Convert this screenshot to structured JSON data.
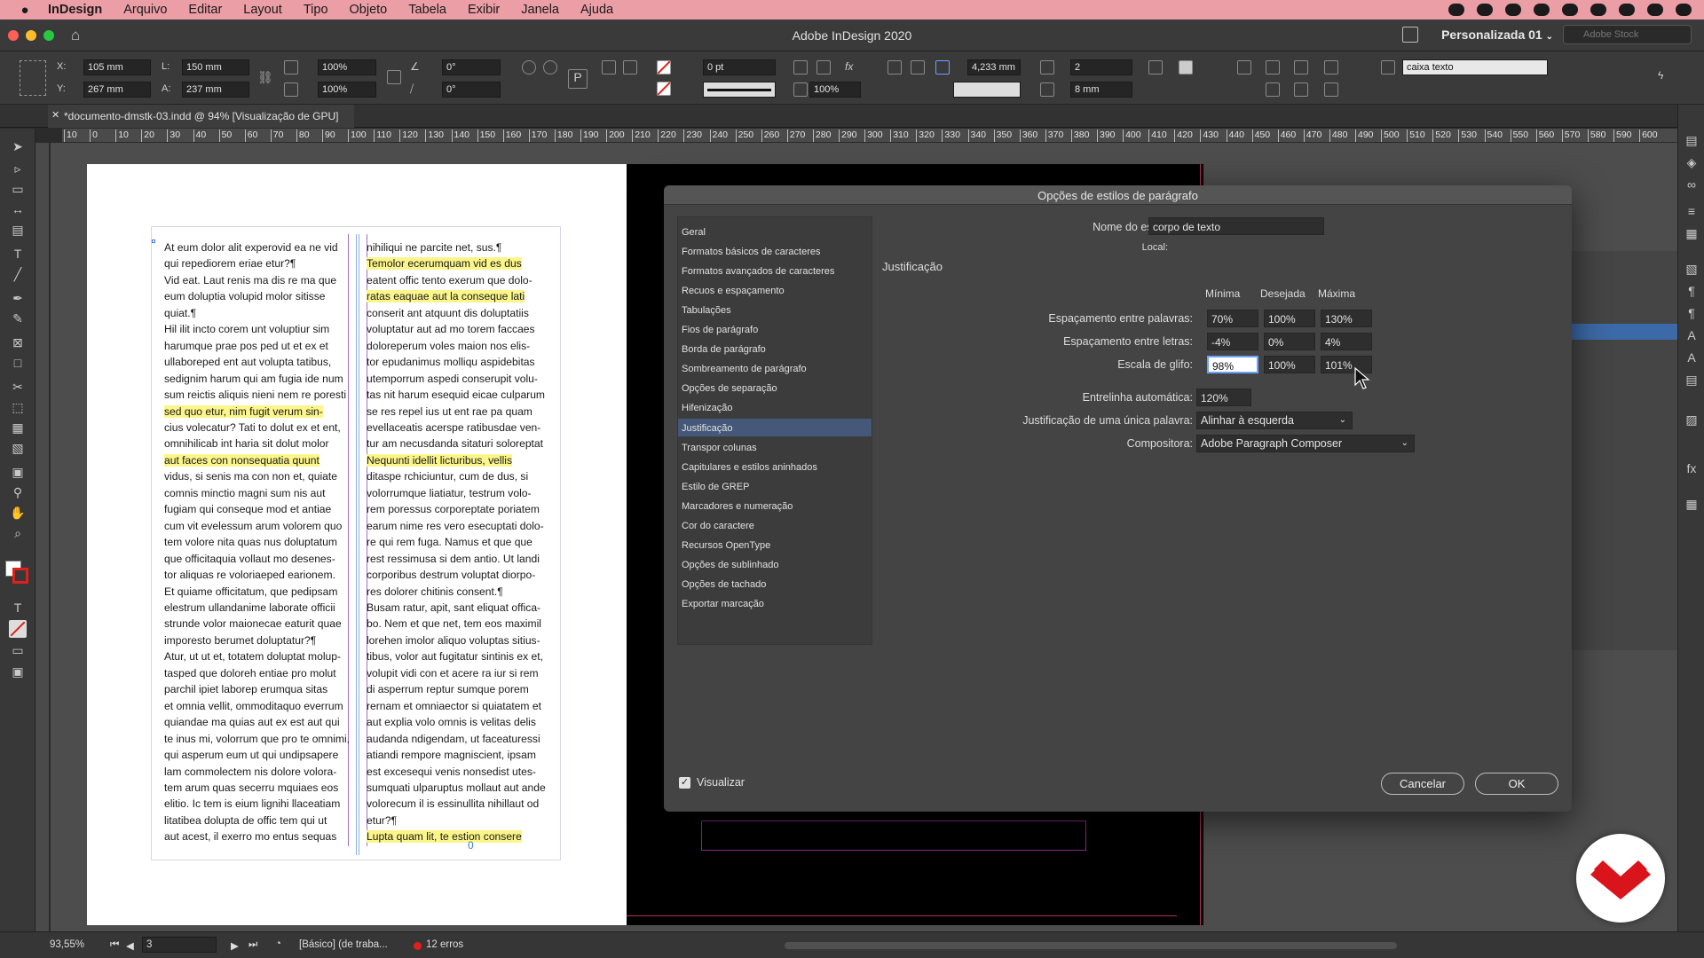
{
  "menubar": {
    "app": "InDesign",
    "items": [
      "Arquivo",
      "Editar",
      "Layout",
      "Tipo",
      "Objeto",
      "Tabela",
      "Exibir",
      "Janela",
      "Ajuda"
    ]
  },
  "titlebar": {
    "title": "Adobe InDesign 2020",
    "workspace": "Personalizada 01",
    "stock_placeholder": "Adobe Stock"
  },
  "control": {
    "x_label": "X:",
    "x": "105 mm",
    "y_label": "Y:",
    "y": "267 mm",
    "l_label": "L:",
    "l": "150 mm",
    "a_label": "A:",
    "a": "237 mm",
    "scale_x": "100%",
    "scale_y": "100%",
    "rotate": "0°",
    "shear": "0°",
    "stroke_weight": "0 pt",
    "opacity": "100%",
    "inset": "4,233 mm",
    "columns": "2",
    "gutter": "8 mm",
    "object_style": "caixa texto"
  },
  "tab": {
    "title": "*documento-dmstk-03.indd @ 94% [Visualização de GPU]"
  },
  "ruler_ticks": [
    "10",
    "0",
    "10",
    "20",
    "30",
    "40",
    "50",
    "60",
    "70",
    "80",
    "90",
    "100",
    "110",
    "120",
    "130",
    "140",
    "150",
    "160",
    "170",
    "180",
    "190",
    "200",
    "210",
    "220",
    "230",
    "240",
    "250",
    "260",
    "270",
    "280",
    "290",
    "300",
    "310",
    "320",
    "330",
    "340",
    "350",
    "360",
    "370",
    "380",
    "390",
    "400",
    "410",
    "420",
    "430",
    "440",
    "450",
    "460",
    "470",
    "480",
    "490",
    "500",
    "510",
    "520",
    "530",
    "540",
    "550",
    "560",
    "570",
    "580",
    "590",
    "600"
  ],
  "text_col1": [
    "At eum dolor alit experovid ea ne vid",
    "qui repediorem eriae etur?¶",
    "Vid eat. Laut renis ma dis re ma que",
    "eum doluptia volupid molor sitisse",
    "quiat.¶",
    "Hil ilit incto corem unt voluptiur sim",
    "harumque prae pos ped ut et ex et",
    "ullaboreped ent aut volupta tatibus,",
    "sedignim harum qui am fugia ide num",
    "sum reictis aliquis nieni nem re poresti",
    "sed quo etur, nim fugit verum sin-",
    "cius volecatur? Tati to dolut ex et ent,",
    "omnihilicab int haria sit dolut molor",
    "aut faces con nonsequatia quunt",
    "vidus, si senis ma con non et, quiate",
    "comnis minctio magni sum nis aut",
    "fugiam qui conseque mod et antiae",
    "cum vit evelessum arum volorem quo",
    "tem volore nita quas nus doluptatum",
    "que officitaquia vollaut mo desenes-",
    "tor aliquas re voloriaeped earionem.",
    "Et quiame officitatum, que pedipsam",
    "elestrum ullandanime laborate officii",
    "strunde volor maionecae eaturit quae",
    "imporesto berumet doluptatur?¶",
    "Atur, ut ut et, totatem doluptat molup-",
    "tasped que doloreh entiae pro molut",
    "parchil ipiet laborep erumqua sitas",
    "et omnia vellit, ommoditaquo everrum",
    "quiandae ma quias aut ex est aut qui",
    "te inus mi, volorrum que pro te omnimi,",
    "qui asperum eum ut qui undipsapere",
    "lam commolectem nis dolore volora-",
    "tem arum quas secerru mquiaes eos",
    "elitio. Ic tem is eium lignihi llaceatiam",
    "litatibea dolupta de offic tem qui ut",
    "aut acest, il exerro mo entus sequas"
  ],
  "text_col2": [
    "nihiliqui ne parcite net, sus.¶",
    "Temolor ecerumquam vid es dus",
    "eatent offic tento exerum que dolo-",
    "ratas eaquae aut la conseque lati",
    "conserit ant atquunt dis doluptatiis",
    "voluptatur aut ad mo torem faccaes",
    "doloreperum voles maion nos elis-",
    "tor epudanimus molliqu aspidebitas",
    "utemporrum aspedi conserupit volu-",
    "tas nit harum esequid eicae culparum",
    "se res repel ius ut ent rae pa quam",
    "evellaceatis acerspe ratibusdae ven-",
    "tur am necusdanda sitaturi soloreptat",
    "Nequunti idellit licturibus, vellis",
    "ditaspe rchiciuntur, cum de dus, si",
    "volorrumque liatiatur, testrum volo-",
    "rem poressus corporeptate poriatem",
    "earum nime res vero esecuptati dolo-",
    "re qui rem fuga. Namus et que que",
    "rest ressimusa si dem antio. Ut landi",
    "corporibus destrum voluptat diorpo-",
    "res dolorer chitinis consent.¶",
    "Busam ratur, apit, sant eliquat offica-",
    "bo. Nem et que net, tem eos maximil",
    "lorehen imolor aliquo voluptas sitius-",
    "tibus, volor aut fugitatur sintinis ex et,",
    "volupit vidi con et acere ra iur si rem",
    "di asperrum reptur sumque porem",
    "rernam et omniaector si quiatatem et",
    "aut explia volo omnis is velitas delis",
    "audanda ndigendam, ut faceaturessi",
    "atiandi rempore magniscient, ipsam",
    "est excesequi venis nonsedist utes-",
    "sumquati ulparuptus mollaut aut ande",
    "volorecum il is essinullita nihillaut od",
    "etur?¶",
    "Lupta quam lit, te estion consere"
  ],
  "dialog": {
    "title": "Opções de estilos de parágrafo",
    "categories": [
      "Geral",
      "Formatos básicos de caracteres",
      "Formatos avançados de caracteres",
      "Recuos e espaçamento",
      "Tabulações",
      "Fios de parágrafo",
      "Borda de parágrafo",
      "Sombreamento de parágrafo",
      "Opções de separação",
      "Hifenização",
      "Justificação",
      "Transpor colunas",
      "Capitulares e estilos aninhados",
      "Estilo de GREP",
      "Marcadores e numeração",
      "Cor do caractere",
      "Recursos OpenType",
      "Opções de sublinhado",
      "Opções de tachado",
      "Exportar marcação"
    ],
    "selected_index": 10,
    "style_name_label": "Nome do estilo:",
    "style_name": "corpo de texto",
    "local_label": "Local:",
    "section_title": "Justificação",
    "col_min": "Mínima",
    "col_des": "Desejada",
    "col_max": "Máxima",
    "word_spacing_label": "Espaçamento entre palavras:",
    "word_spacing": [
      "70%",
      "100%",
      "130%"
    ],
    "letter_spacing_label": "Espaçamento entre letras:",
    "letter_spacing": [
      "-4%",
      "0%",
      "4%"
    ],
    "glyph_scaling_label": "Escala de glifo:",
    "glyph_scaling": [
      "98%",
      "100%",
      "101%"
    ],
    "auto_leading_label": "Entrelinha automática:",
    "auto_leading": "120%",
    "single_word_label": "Justificação de uma única palavra:",
    "single_word": "Alinhar à esquerda",
    "composer_label": "Compositora:",
    "composer": "Adobe Paragraph Composer",
    "preview_label": "Visualizar",
    "cancel": "Cancelar",
    "ok": "OK"
  },
  "status": {
    "zoom": "93,55%",
    "page": "3",
    "profile": "[Básico] (de traba...",
    "errors": "12 erros"
  },
  "colors": {
    "menubar": "#eb9ea6",
    "highlight": "#fbf58a",
    "selected_item": "#45587a",
    "logo_red": "#d9141b"
  }
}
